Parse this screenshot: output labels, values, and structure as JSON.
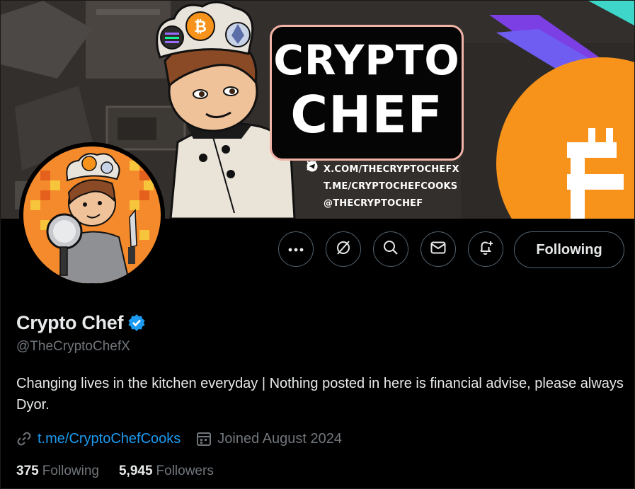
{
  "banner": {
    "title_line1": "CRYPTO",
    "title_line2": "CHEF",
    "links": [
      {
        "icon": "x-logo-icon",
        "text": "X.COM/THECRYPTOCHEFX"
      },
      {
        "icon": "telegram-icon",
        "text": "T.ME/CRYPTOCHEFCOOKS"
      },
      {
        "icon": "telegram-icon",
        "text": "@THECRYPTOCHEF"
      }
    ],
    "hat_coin_symbol": "₿",
    "big_coin_symbol": "B"
  },
  "profile": {
    "display_name": "Crypto Chef",
    "verified": true,
    "handle": "@TheCryptoChefX",
    "bio": "Changing lives in the kitchen everyday | Nothing posted in here is financial advise, please always Dyor.",
    "link_text": "t.me/CryptoChefCooks",
    "joined": "Joined August 2024",
    "following_count": "375",
    "following_label": "Following",
    "followers_count": "5,945",
    "followers_label": "Followers"
  },
  "actions": {
    "more_icon": "more-dots-icon",
    "grok_icon": "grok-icon",
    "search_icon": "search-icon",
    "message_icon": "message-icon",
    "notify_icon": "notification-bell-plus-icon",
    "following_button_label": "Following"
  },
  "colors": {
    "background": "#000000",
    "accent_link": "#1d9bf0",
    "verified_badge": "#1d9bf0",
    "text_primary": "#e7e9ea",
    "text_secondary": "#71767b",
    "button_border": "#536471",
    "bitcoin_orange": "#f7931a",
    "banner_box_border": "#f1b3a6"
  }
}
